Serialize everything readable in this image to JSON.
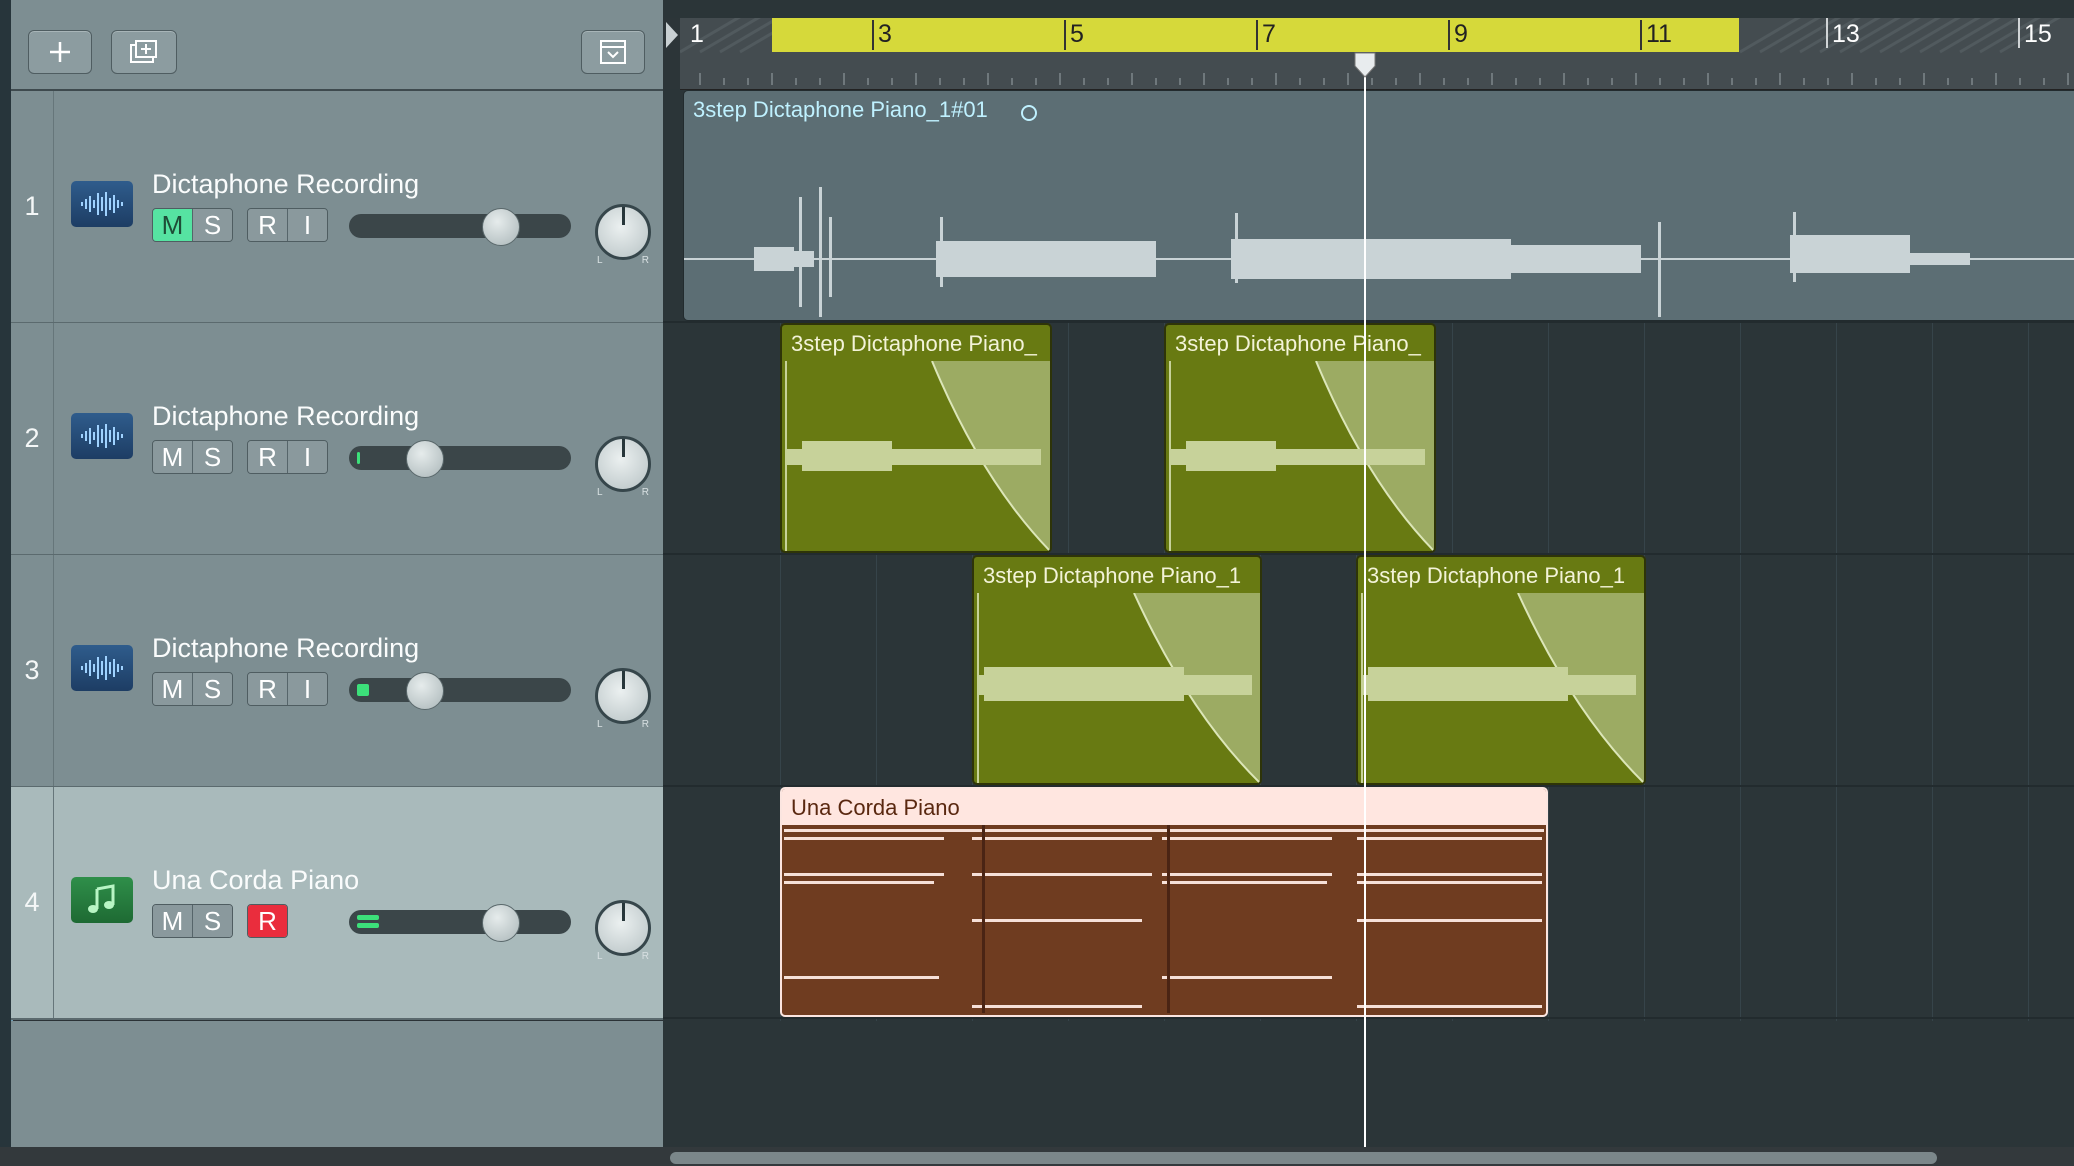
{
  "header": {
    "add_track_icon": "plus-icon",
    "duplicate_icon": "duplicate-track-icon",
    "collapse_icon": "chevron-down-box-icon"
  },
  "ruler": {
    "bars": [
      "1",
      "3",
      "5",
      "7",
      "9",
      "11",
      "13",
      "15"
    ],
    "cycle_color": "#d6d93a"
  },
  "tracks": [
    {
      "number": "1",
      "name": "Dictaphone Recording",
      "type": "audio",
      "mute": "M",
      "solo": "S",
      "record": "R",
      "input": "I",
      "mute_on": true,
      "record_on": false,
      "volume": 0.72,
      "meter": 0.0,
      "pan_left": "L",
      "pan_right": "R"
    },
    {
      "number": "2",
      "name": "Dictaphone Recording",
      "type": "audio",
      "mute": "M",
      "solo": "S",
      "record": "R",
      "input": "I",
      "mute_on": false,
      "record_on": false,
      "volume": 0.36,
      "meter": 0.02,
      "pan_left": "L",
      "pan_right": "R"
    },
    {
      "number": "3",
      "name": "Dictaphone Recording",
      "type": "audio",
      "mute": "M",
      "solo": "S",
      "record": "R",
      "input": "I",
      "mute_on": false,
      "record_on": false,
      "volume": 0.36,
      "meter": 0.05,
      "pan_left": "L",
      "pan_right": "R"
    },
    {
      "number": "4",
      "name": "Una Corda Piano",
      "type": "midi",
      "mute": "M",
      "solo": "S",
      "record": "R",
      "mute_on": false,
      "record_on": true,
      "volume": 0.72,
      "meter": 0.1,
      "pan_left": "L",
      "pan_right": "R"
    }
  ],
  "regions": {
    "track1": "3step Dictaphone Piano_1#01",
    "track2a": "3step Dictaphone Piano_",
    "track2b": "3step Dictaphone Piano_",
    "track3a": "3step Dictaphone Piano_1",
    "track3b": "3step Dictaphone Piano_1",
    "track4": "Una Corda Piano"
  },
  "colors": {
    "audio_region": "#687a12",
    "midi_region": "#6f3c20",
    "mute_active": "#56e3a2",
    "record_active": "#ea2d3d",
    "track1_region": "#5c6e74"
  }
}
